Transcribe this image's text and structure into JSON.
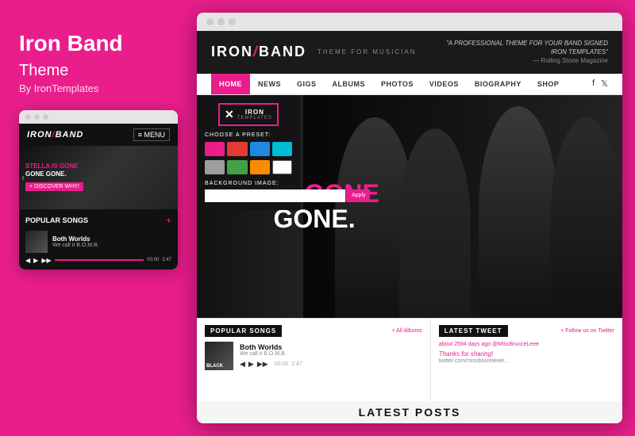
{
  "left": {
    "title": "Iron Band",
    "subtitle": "Theme",
    "by": "By IronTemplates"
  },
  "small_mockup": {
    "logo": "IRON",
    "logo_slash": "/",
    "logo_band": "BAND",
    "menu": "≡ MENU",
    "hero_line1": "STELLA IS GONE",
    "hero_line2": "GONE GONE.",
    "discover": "+ DISCOVER WHY!",
    "popular_songs_title": "POPULAR SONGS",
    "song_name": "Both Worlds",
    "song_sub": "We call it B.O.M.B.",
    "time_start": "00:00",
    "time_end": "2:47"
  },
  "big_mockup": {
    "logo": "IRON",
    "logo_slash": "/",
    "logo_band": "BAND",
    "tagline": "THEME FOR MUSICIAN",
    "quote": "\"A PROFESSIONAL THEME FOR YOUR BAND SIGNED IRON TEMPLATES\"",
    "quote_source": "— Rolling Stone Magazine",
    "nav": [
      "HOME",
      "NEWS",
      "GIGS",
      "ALBUMS",
      "PHOTOS",
      "VIDEOS",
      "BIOGRAPHY",
      "SHOP"
    ],
    "active_nav": "HOME",
    "hero_line1": "IS GONE",
    "hero_line2": "GONE.",
    "preset_label": "CHOOSE A PRESET:",
    "preset_colors_1": [
      "#e91e8c",
      "#e53935",
      "#1e88e5",
      "#00bcd4"
    ],
    "preset_colors_2": [
      "#9e9e9e",
      "#43a047",
      "#fb8c00",
      "#ffffff"
    ],
    "bg_image_label": "BACKGROUND IMAGE:",
    "apply_btn": "Apply",
    "popular_songs_title": "POPULAR SONGS",
    "all_albums_link": "+ All Albums",
    "latest_tweet_title": "LATEST TWEET",
    "follow_twitter": "+ Follow us on Twitter",
    "song_name": "Both Worlds",
    "song_sub": "We call it B.O.M.B.",
    "song_thumb_label": "BLACK",
    "tweet_ago": "about 2594 days ago",
    "tweet_user": "@MissBrucceLeee",
    "tweet_text": "Thanks for sharing!",
    "tweet_link": "twitter.com/missbruceleee/...",
    "time_start": "00:00",
    "time_end": "2:47",
    "latest_posts": "LATEST POSTS"
  }
}
